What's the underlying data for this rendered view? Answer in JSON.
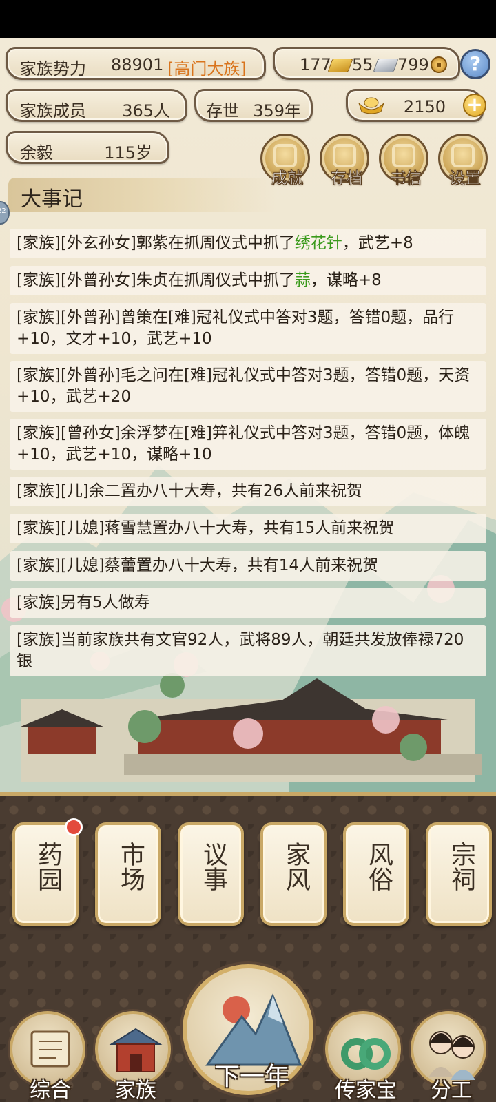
{
  "stats": {
    "power_label": "家族势力",
    "power_value": "88901",
    "power_rank": "[高门大族]",
    "gold": "177",
    "silver": "55",
    "coins": "799",
    "members_label": "家族成员",
    "members_value": "365人",
    "age_label": "存世",
    "age_value": "359年",
    "ingots": "2150",
    "patriarch_name": "余毅",
    "patriarch_age": "115岁"
  },
  "menu": {
    "achievements": "成就",
    "save": "存档",
    "letters": "书信",
    "settings": "设置"
  },
  "events_title": "大事记",
  "events": [
    {
      "prefix": "[家族][外玄孙女]郭紫在抓周仪式中抓了",
      "item": "绣花针",
      "suffix": "，武艺+8"
    },
    {
      "prefix": "[家族][外曾孙女]朱贞在抓周仪式中抓了",
      "item": "蒜",
      "suffix": "，谋略+8"
    },
    {
      "text": "[家族][外曾孙]曾策在[难]冠礼仪式中答对3题，答错0题，品行+10，文才+10，武艺+10"
    },
    {
      "text": "[家族][外曾孙]毛之问在[难]冠礼仪式中答对3题，答错0题，天资+10，武艺+20"
    },
    {
      "text": "[家族][曾孙女]余浮梦在[难]笄礼仪式中答对3题，答错0题，体魄+10，武艺+10，谋略+10"
    },
    {
      "text": "[家族][儿]余二置办八十大寿，共有26人前来祝贺"
    },
    {
      "text": "[家族][儿媳]蒋雪慧置办八十大寿，共有15人前来祝贺"
    },
    {
      "text": "[家族][儿媳]蔡蕾置办八十大寿，共有14人前来祝贺"
    },
    {
      "text": "[家族]另有5人做寿"
    },
    {
      "text": "[家族]当前家族共有文官92人，武将89人，朝廷共发放俸禄720银"
    }
  ],
  "cards": [
    "药园",
    "市场",
    "议事",
    "家风",
    "风俗",
    "宗祠"
  ],
  "nav": {
    "overview": "综合",
    "family": "家族",
    "next_year": "下一年",
    "heirloom": "传家宝",
    "division": "分工"
  },
  "side_badge": "22"
}
